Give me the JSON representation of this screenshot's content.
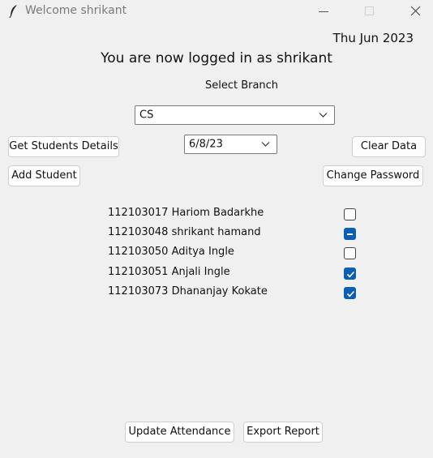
{
  "window": {
    "title": "Welcome shrikant"
  },
  "header": {
    "date": "Thu Jun  2023",
    "logged_in": "You are now logged in as shrikant",
    "select_branch_label": "Select Branch"
  },
  "controls": {
    "branch": "CS",
    "date": "6/8/23",
    "get_students_label": "Get Students Details",
    "clear_label": "Clear Data",
    "add_student_label": "Add Student",
    "change_password_label": "Change Password"
  },
  "students": [
    {
      "label": "112103017 Hariom Badarkhe",
      "state": "unchecked"
    },
    {
      "label": "112103048 shrikant hamand",
      "state": "indeterminate"
    },
    {
      "label": "112103050 Aditya Ingle",
      "state": "unchecked"
    },
    {
      "label": "112103051 Anjali Ingle",
      "state": "checked"
    },
    {
      "label": "112103073 Dhananjay Kokate",
      "state": "checked"
    }
  ],
  "footer": {
    "update_label": "Update Attendance",
    "export_label": "Export Report"
  },
  "colors": {
    "accent": "#0a5fb4",
    "background": "#f0f0f0"
  },
  "icons": {
    "app": "feather-icon",
    "minimize": "minimize-icon",
    "maximize": "maximize-icon",
    "close": "close-icon",
    "dropdown": "chevron-down-icon"
  }
}
